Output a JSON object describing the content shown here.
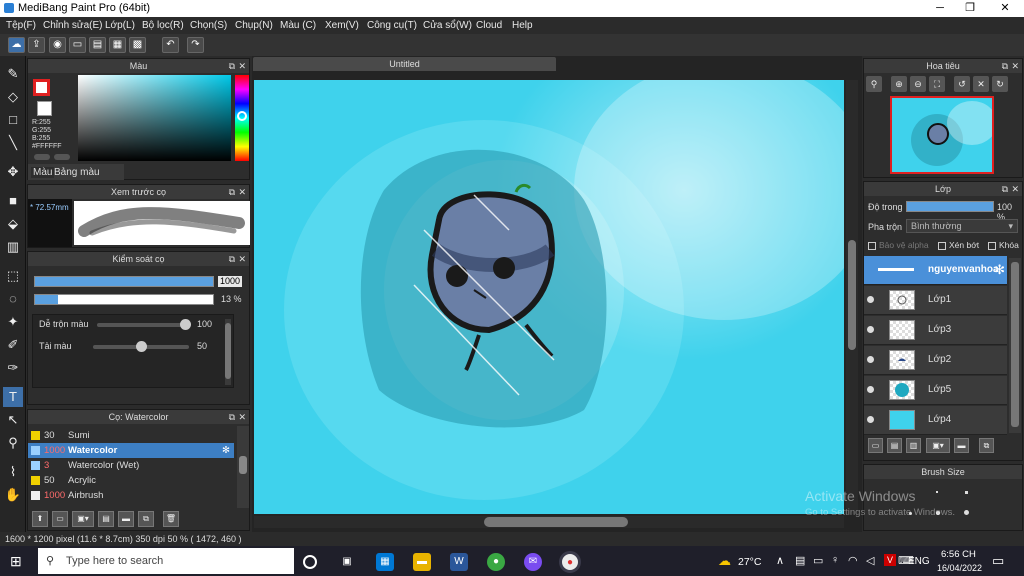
{
  "window": {
    "title": "MediBang Paint Pro (64bit)",
    "minimize": "─",
    "maximize": "❐",
    "close": "✕"
  },
  "menu": [
    "Tệp(F)",
    "Chỉnh sửa(E)",
    "Lớp(L)",
    "Bộ lọc(R)",
    "Chọn(S)",
    "Chụp(N)",
    "Màu (C)",
    "Xem(V)",
    "Công cụ(T)",
    "Cửa sổ(W)",
    "Cloud",
    "Help"
  ],
  "color_panel": {
    "title": "Màu",
    "readout": "R:255\nG:255\nB:255\n#FFFFFF",
    "tabs": [
      "Màu",
      "Bảng màu"
    ]
  },
  "brush_preview": {
    "title": "Xem trước cọ",
    "size": "* 72.57mm"
  },
  "brush_control": {
    "title": "Kiểm soát cọ",
    "size_value": "1000",
    "opacity_value": "13 %",
    "opacity_fraction": 0.13,
    "size_fraction": 1.0,
    "blend_label": "Dễ trộn màu",
    "blend_value": "100",
    "reload_label": "Tải màu",
    "reload_value": "50"
  },
  "brush_list": {
    "title": "Cọ: Watercolor",
    "items": [
      {
        "size": "30",
        "name": "Sumi",
        "color": "#f0d000",
        "selected": false,
        "size_color": "#ddd"
      },
      {
        "size": "1000",
        "name": "Watercolor",
        "color": "#9ad0ff",
        "selected": true,
        "size_color": "#ff6b6b"
      },
      {
        "size": "3",
        "name": "Watercolor (Wet)",
        "color": "#9ad0ff",
        "selected": false,
        "size_color": "#ff6b6b"
      },
      {
        "size": "50",
        "name": "Acrylic",
        "color": "#f0d000",
        "selected": false,
        "size_color": "#ddd"
      },
      {
        "size": "1000",
        "name": "Airbrush",
        "color": "#f0f0f0",
        "selected": false,
        "size_color": "#ff6b6b"
      }
    ]
  },
  "document": {
    "tab": "Untitled"
  },
  "navigator": {
    "title": "Hoa tiêu"
  },
  "layers": {
    "title": "Lớp",
    "opacity_label": "Độ trong",
    "opacity_value": "100 %",
    "blend_label": "Pha trộn",
    "blend_value": "Bình thường",
    "options": [
      "Bảo vệ alpha",
      "Xén bớt",
      "Khóa"
    ],
    "items": [
      {
        "name": "nguyenvanhoa",
        "selected": true
      },
      {
        "name": "Lớp1",
        "selected": false
      },
      {
        "name": "Lớp3",
        "selected": false
      },
      {
        "name": "Lớp2",
        "selected": false
      },
      {
        "name": "Lớp5",
        "selected": false
      },
      {
        "name": "Lớp4",
        "selected": false
      }
    ]
  },
  "brush_size_panel": {
    "title": "Brush Size"
  },
  "watermark": {
    "line1": "Activate Windows",
    "line2": "Go to Settings to activate Windows."
  },
  "status": {
    "text": "1600 * 1200 pixel   (11.6 * 8.7cm)   350 dpi   50 %   ( 1472, 460 )"
  },
  "taskbar": {
    "search_placeholder": "Type here to search",
    "temp": "27°C",
    "lang": "ENG",
    "time": "6:56 CH",
    "date": "16/04/2022"
  },
  "colors": {
    "canvas_bg": "#3fd2ec",
    "accent": "#3d6fa8"
  }
}
